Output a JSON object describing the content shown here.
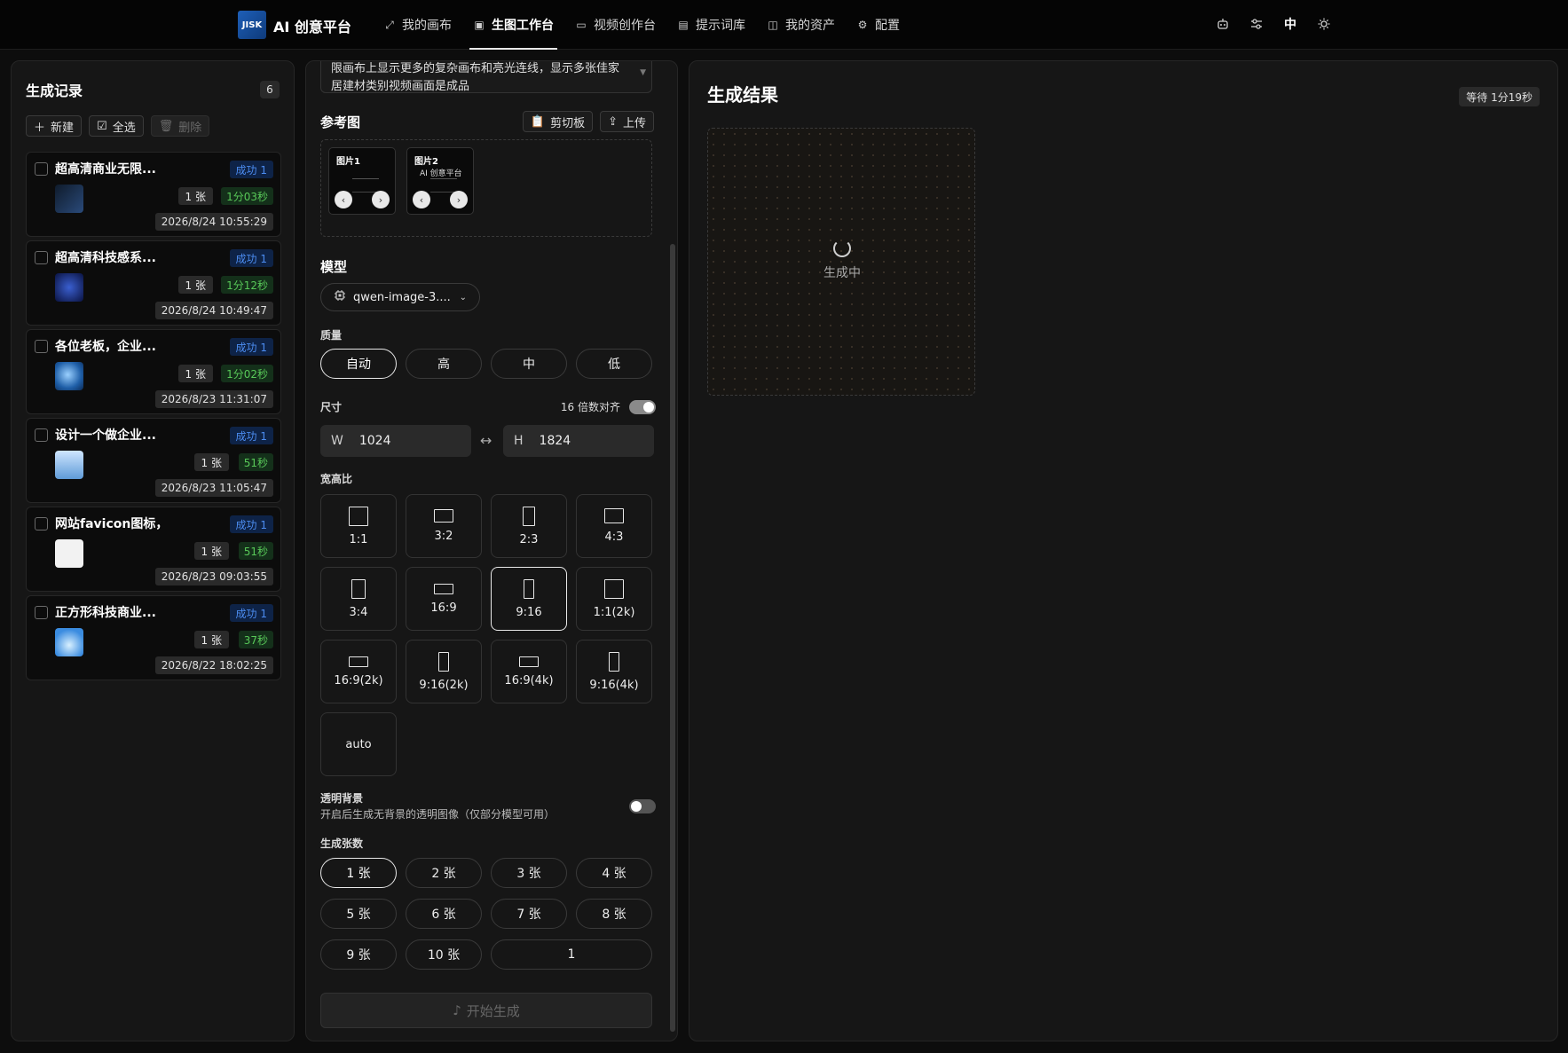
{
  "header": {
    "logo_text": "JISK",
    "brand": "AI 创意平台",
    "nav": [
      {
        "label": "我的画布",
        "icon": "expand-icon",
        "active": false
      },
      {
        "label": "生图工作台",
        "icon": "image-edit-icon",
        "active": true
      },
      {
        "label": "视频创作台",
        "icon": "video-icon",
        "active": false
      },
      {
        "label": "提示词库",
        "icon": "document-icon",
        "active": false
      },
      {
        "label": "我的资产",
        "icon": "gallery-icon",
        "active": false
      },
      {
        "label": "配置",
        "icon": "sliders-icon",
        "active": false
      }
    ],
    "lang": "中"
  },
  "history": {
    "title": "生成记录",
    "count": "6",
    "new_label": "新建",
    "select_all_label": "全选",
    "delete_label": "删除",
    "records": [
      {
        "title": "超高清商业无限...",
        "status": "成功 1",
        "count": "1 张",
        "duration": "1分03秒",
        "time": "2026/8/24 10:55:29"
      },
      {
        "title": "超高清科技感系...",
        "status": "成功 1",
        "count": "1 张",
        "duration": "1分12秒",
        "time": "2026/8/24 10:49:47"
      },
      {
        "title": "各位老板，企业...",
        "status": "成功 1",
        "count": "1 张",
        "duration": "1分02秒",
        "time": "2026/8/23 11:31:07"
      },
      {
        "title": "设计一个做企业...",
        "status": "成功 1",
        "count": "1 张",
        "duration": "51秒",
        "time": "2026/8/23 11:05:47"
      },
      {
        "title": "网站favicon图标，",
        "status": "成功 1",
        "count": "1 张",
        "duration": "51秒",
        "time": "2026/8/23 09:03:55"
      },
      {
        "title": "正方形科技商业...",
        "status": "成功 1",
        "count": "1 张",
        "duration": "37秒",
        "time": "2026/8/22 18:02:25"
      }
    ]
  },
  "form": {
    "prompt_text": "限画布上显示更多的复杂画布和亮光连线，显示多张佳家居建材类别视频画面是成品",
    "reference": {
      "title": "参考图",
      "clipboard_label": "剪切板",
      "upload_label": "上传",
      "images": [
        {
          "label": "图片1",
          "sub": ""
        },
        {
          "label": "图片2",
          "sub": "AI 创意平台"
        }
      ]
    },
    "model": {
      "title": "模型",
      "value": "qwen-image-3...."
    },
    "quality": {
      "title": "质量",
      "options": [
        "自动",
        "高",
        "中",
        "低"
      ],
      "selected": 0
    },
    "size": {
      "title": "尺寸",
      "align_label": "16 倍数对齐",
      "align_on": true,
      "w_label": "W",
      "w_value": "1024",
      "h_label": "H",
      "h_value": "1824"
    },
    "aspect": {
      "title": "宽高比",
      "options": [
        "1:1",
        "3:2",
        "2:3",
        "4:3",
        "3:4",
        "16:9",
        "9:16",
        "1:1(2k)",
        "16:9(2k)",
        "9:16(2k)",
        "16:9(4k)",
        "9:16(4k)",
        "auto"
      ],
      "selected": 6
    },
    "transparent": {
      "title": "透明背景",
      "desc": "开启后生成无背景的透明图像（仅部分模型可用）",
      "on": false
    },
    "count": {
      "title": "生成张数",
      "options": [
        "1 张",
        "2 张",
        "3 张",
        "4 张",
        "5 张",
        "6 张",
        "7 张",
        "8 张",
        "9 张",
        "10 张"
      ],
      "custom_value": "1",
      "selected": 0
    },
    "generate_label": "开始生成"
  },
  "result": {
    "title": "生成结果",
    "wait": "等待 1分19秒",
    "generating": "生成中"
  },
  "colors": {
    "success_badge": "#4c8cf0",
    "duration_badge": "#58c858",
    "accent": "#e8e8e8"
  }
}
